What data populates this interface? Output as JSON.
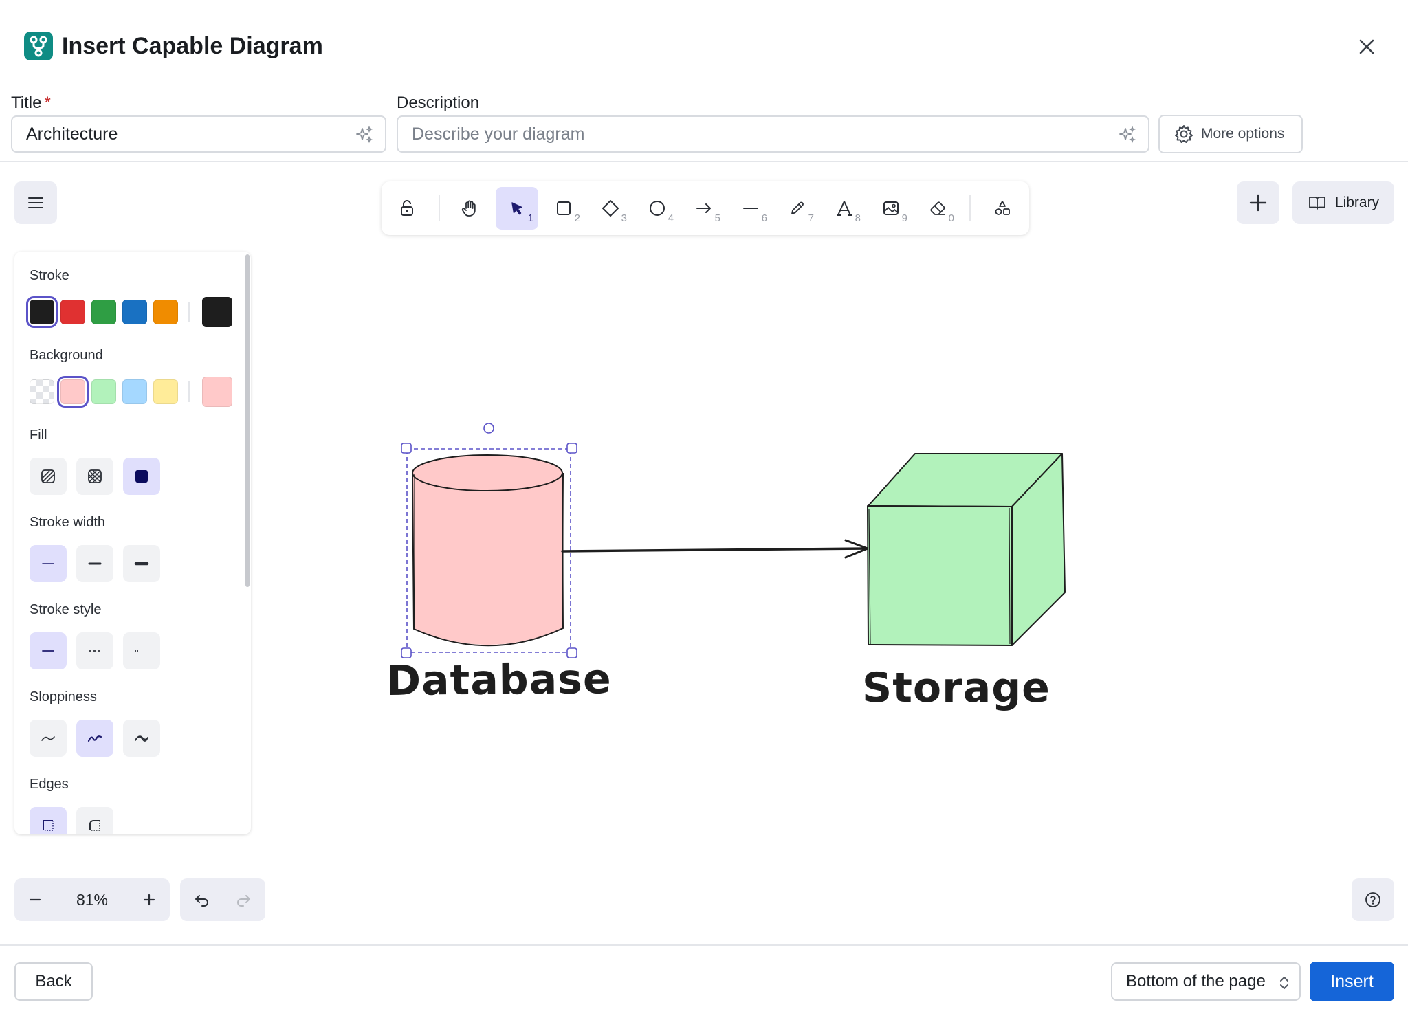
{
  "dialog": {
    "title": "Insert Capable Diagram",
    "close_icon": "close-icon"
  },
  "form": {
    "title_label": "Title",
    "required_mark": "*",
    "title_value": "Architecture",
    "description_label": "Description",
    "description_value": "",
    "description_placeholder": "Describe your diagram",
    "more_options_label": "More options"
  },
  "toolbar": {
    "tools": [
      {
        "name": "lock",
        "icon": "lock-open-icon",
        "key": ""
      },
      {
        "name": "hand",
        "icon": "hand-icon",
        "key": ""
      },
      {
        "name": "selection",
        "icon": "pointer-icon",
        "key": "1",
        "active": true
      },
      {
        "name": "rectangle",
        "icon": "square-icon",
        "key": "2"
      },
      {
        "name": "diamond",
        "icon": "diamond-icon",
        "key": "3"
      },
      {
        "name": "ellipse",
        "icon": "circle-icon",
        "key": "4"
      },
      {
        "name": "arrow",
        "icon": "arrow-icon",
        "key": "5"
      },
      {
        "name": "line",
        "icon": "line-icon",
        "key": "6"
      },
      {
        "name": "draw",
        "icon": "pencil-icon",
        "key": "7"
      },
      {
        "name": "text",
        "icon": "text-icon",
        "key": "8"
      },
      {
        "name": "image",
        "icon": "image-icon",
        "key": "9"
      },
      {
        "name": "eraser",
        "icon": "eraser-icon",
        "key": "0"
      },
      {
        "name": "shapes",
        "icon": "shapes-icon",
        "key": ""
      }
    ],
    "library_label": "Library"
  },
  "properties": {
    "stroke_label": "Stroke",
    "stroke_colors": [
      "#1e1e1e",
      "#e03131",
      "#2f9e44",
      "#1971c2",
      "#f08c00"
    ],
    "stroke_current": "#1e1e1e",
    "background_label": "Background",
    "background_colors": [
      "transparent",
      "#ffc9c9",
      "#b2f2bb",
      "#a5d8ff",
      "#ffec99"
    ],
    "background_current": "#ffc9c9",
    "fill_label": "Fill",
    "fill_options": [
      "hachure",
      "cross-hatch",
      "solid"
    ],
    "fill_selected": "solid",
    "stroke_width_label": "Stroke width",
    "stroke_width_options": [
      "thin",
      "bold",
      "extra-bold"
    ],
    "stroke_width_selected": "thin",
    "stroke_style_label": "Stroke style",
    "stroke_style_options": [
      "solid",
      "dashed",
      "dotted"
    ],
    "stroke_style_selected": "solid",
    "sloppiness_label": "Sloppiness",
    "sloppiness_options": [
      "architect",
      "artist",
      "cartoonist"
    ],
    "sloppiness_selected": "artist",
    "edges_label": "Edges",
    "edges_options": [
      "sharp",
      "round"
    ],
    "edges_selected": "sharp"
  },
  "canvas": {
    "elements": [
      {
        "type": "cylinder",
        "label": "Database",
        "fill": "#ffc9c9",
        "selected": true
      },
      {
        "type": "arrow",
        "from": "Database",
        "to": "Storage"
      },
      {
        "type": "cube",
        "label": "Storage",
        "fill": "#b2f2bb"
      }
    ]
  },
  "zoom": {
    "value": "81%"
  },
  "footer": {
    "back_label": "Back",
    "position_value": "Bottom of the page",
    "insert_label": "Insert"
  }
}
